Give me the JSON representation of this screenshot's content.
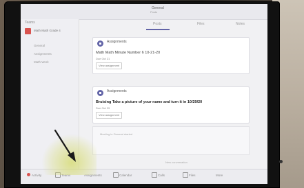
{
  "app": {
    "team_title": "General",
    "team_subtitle": "Posts"
  },
  "sidebar": {
    "header_left": "Teams",
    "header_right": "",
    "team_name": "Math Math Grade 4",
    "channels": [
      "General",
      "Assignments",
      "Math Work"
    ]
  },
  "tabs": {
    "items": [
      "Posts",
      "Files",
      "Notes"
    ],
    "active": "Posts"
  },
  "replies_note": "",
  "cards": [
    {
      "label": "Assignments",
      "date": "",
      "title": "Math Math Minute Number 6 10-21-20",
      "due": "Due Oct 21",
      "button": "View assignment"
    },
    {
      "label": "Assignments",
      "date": "",
      "title": "Bruising Take a picture of your name and turn it in 10/29/20",
      "due": "Due Oct 29",
      "button": "View assignment"
    }
  ],
  "reply": {
    "line1": "Meeting in General started",
    "line2": ""
  },
  "new_conversation": "New conversation",
  "bottom_nav": {
    "items": [
      "Activity",
      "Teams",
      "Assignments",
      "Calendar",
      "Calls",
      "Files",
      "More"
    ],
    "active": "Teams",
    "accent": "#6264a7",
    "notification": "#d9534f"
  }
}
